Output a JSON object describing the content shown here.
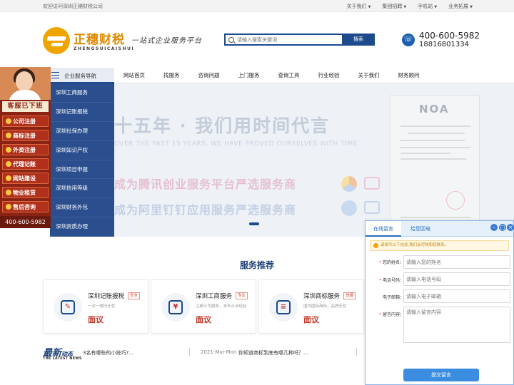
{
  "topbar": {
    "welcome": "欢迎访问深圳正穗财税公司",
    "links": [
      "关于我们",
      "集团招聘",
      "手机站",
      "业务拓展"
    ]
  },
  "header": {
    "logo_cn": "正穗财税",
    "logo_en": "ZHENGSUICAISHUI",
    "slogan": "一站式企业服务平台",
    "search_placeholder": "请输入搜索关键词",
    "search_button": "搜索",
    "phone_primary": "400-600-5982",
    "phone_secondary": "18816801334"
  },
  "nav": {
    "category_label": "企业服务导航",
    "items": [
      "网站首页",
      "找服务",
      "咨询问题",
      "上门服务",
      "查询工具",
      "行业经验",
      "关于我们",
      "财务顾问"
    ]
  },
  "sidemenu": [
    "深圳工商服务",
    "深圳记账报税",
    "深圳社保办理",
    "深圳知识产权",
    "深圳项目申报",
    "深圳信用等级",
    "深圳财务外包",
    "深圳资质办理"
  ],
  "customer_service": {
    "badge": "客服已下班",
    "buttons": [
      "公司注册",
      "商标注册",
      "外资注册",
      "代理记账",
      "网站建设",
      "物业租赁",
      "售后咨询"
    ],
    "phone": "400-600-5982"
  },
  "banner": {
    "headline": "十五年 · 我们用时间代言",
    "english": "OVER THE PAST 15 YEARS, WE HAVE PROVED OURSELVES WITH TIME",
    "line1": "成为腾讯创业服务平台严选服务商",
    "line2": "成为阿里钉钉应用服务严选服务商",
    "cert_title": "NOA"
  },
  "services": {
    "title": "服务推荐",
    "cards": [
      {
        "name": "深圳记账报税",
        "tag": "安全",
        "desc": "一对一哪问无忧",
        "price": "面议"
      },
      {
        "name": "深圳工商服务",
        "tag": "专业",
        "desc": "注册公司服务，多年从业经验",
        "price": "面议"
      },
      {
        "name": "深圳商标服务",
        "tag": "快捷",
        "desc": "国内国际商标，品牌无忧",
        "price": "面议"
      }
    ]
  },
  "news": {
    "logo_main": "最新",
    "logo_sub": "动态",
    "logo_en": "THE LATEST NEWS",
    "item1": "3名有哪些的小技巧?...",
    "date2": "2021-Mar-Mon",
    "item2": "你知道商标到底有哪几种吗？..."
  },
  "message_panel": {
    "tab_active": "在线留言",
    "tab_other": "给您回电",
    "notice": "请填写以下信息,我们会尽快和您联系。",
    "fields": [
      {
        "label": "您的姓名：",
        "required": true,
        "placeholder": "请输入您的姓名"
      },
      {
        "label": "电话号码：",
        "required": true,
        "placeholder": "请输入电话号码"
      },
      {
        "label": "电子邮箱：",
        "required": false,
        "placeholder": "请输入电子邮箱"
      },
      {
        "label": "留言内容：",
        "required": true,
        "placeholder": "请输入留言内容"
      }
    ],
    "submit": "提交留言"
  },
  "colors": {
    "brand_blue": "#1c4a8c",
    "brand_orange": "#e08a00",
    "cs_red": "#8a2314",
    "price_red": "#c0392b"
  }
}
